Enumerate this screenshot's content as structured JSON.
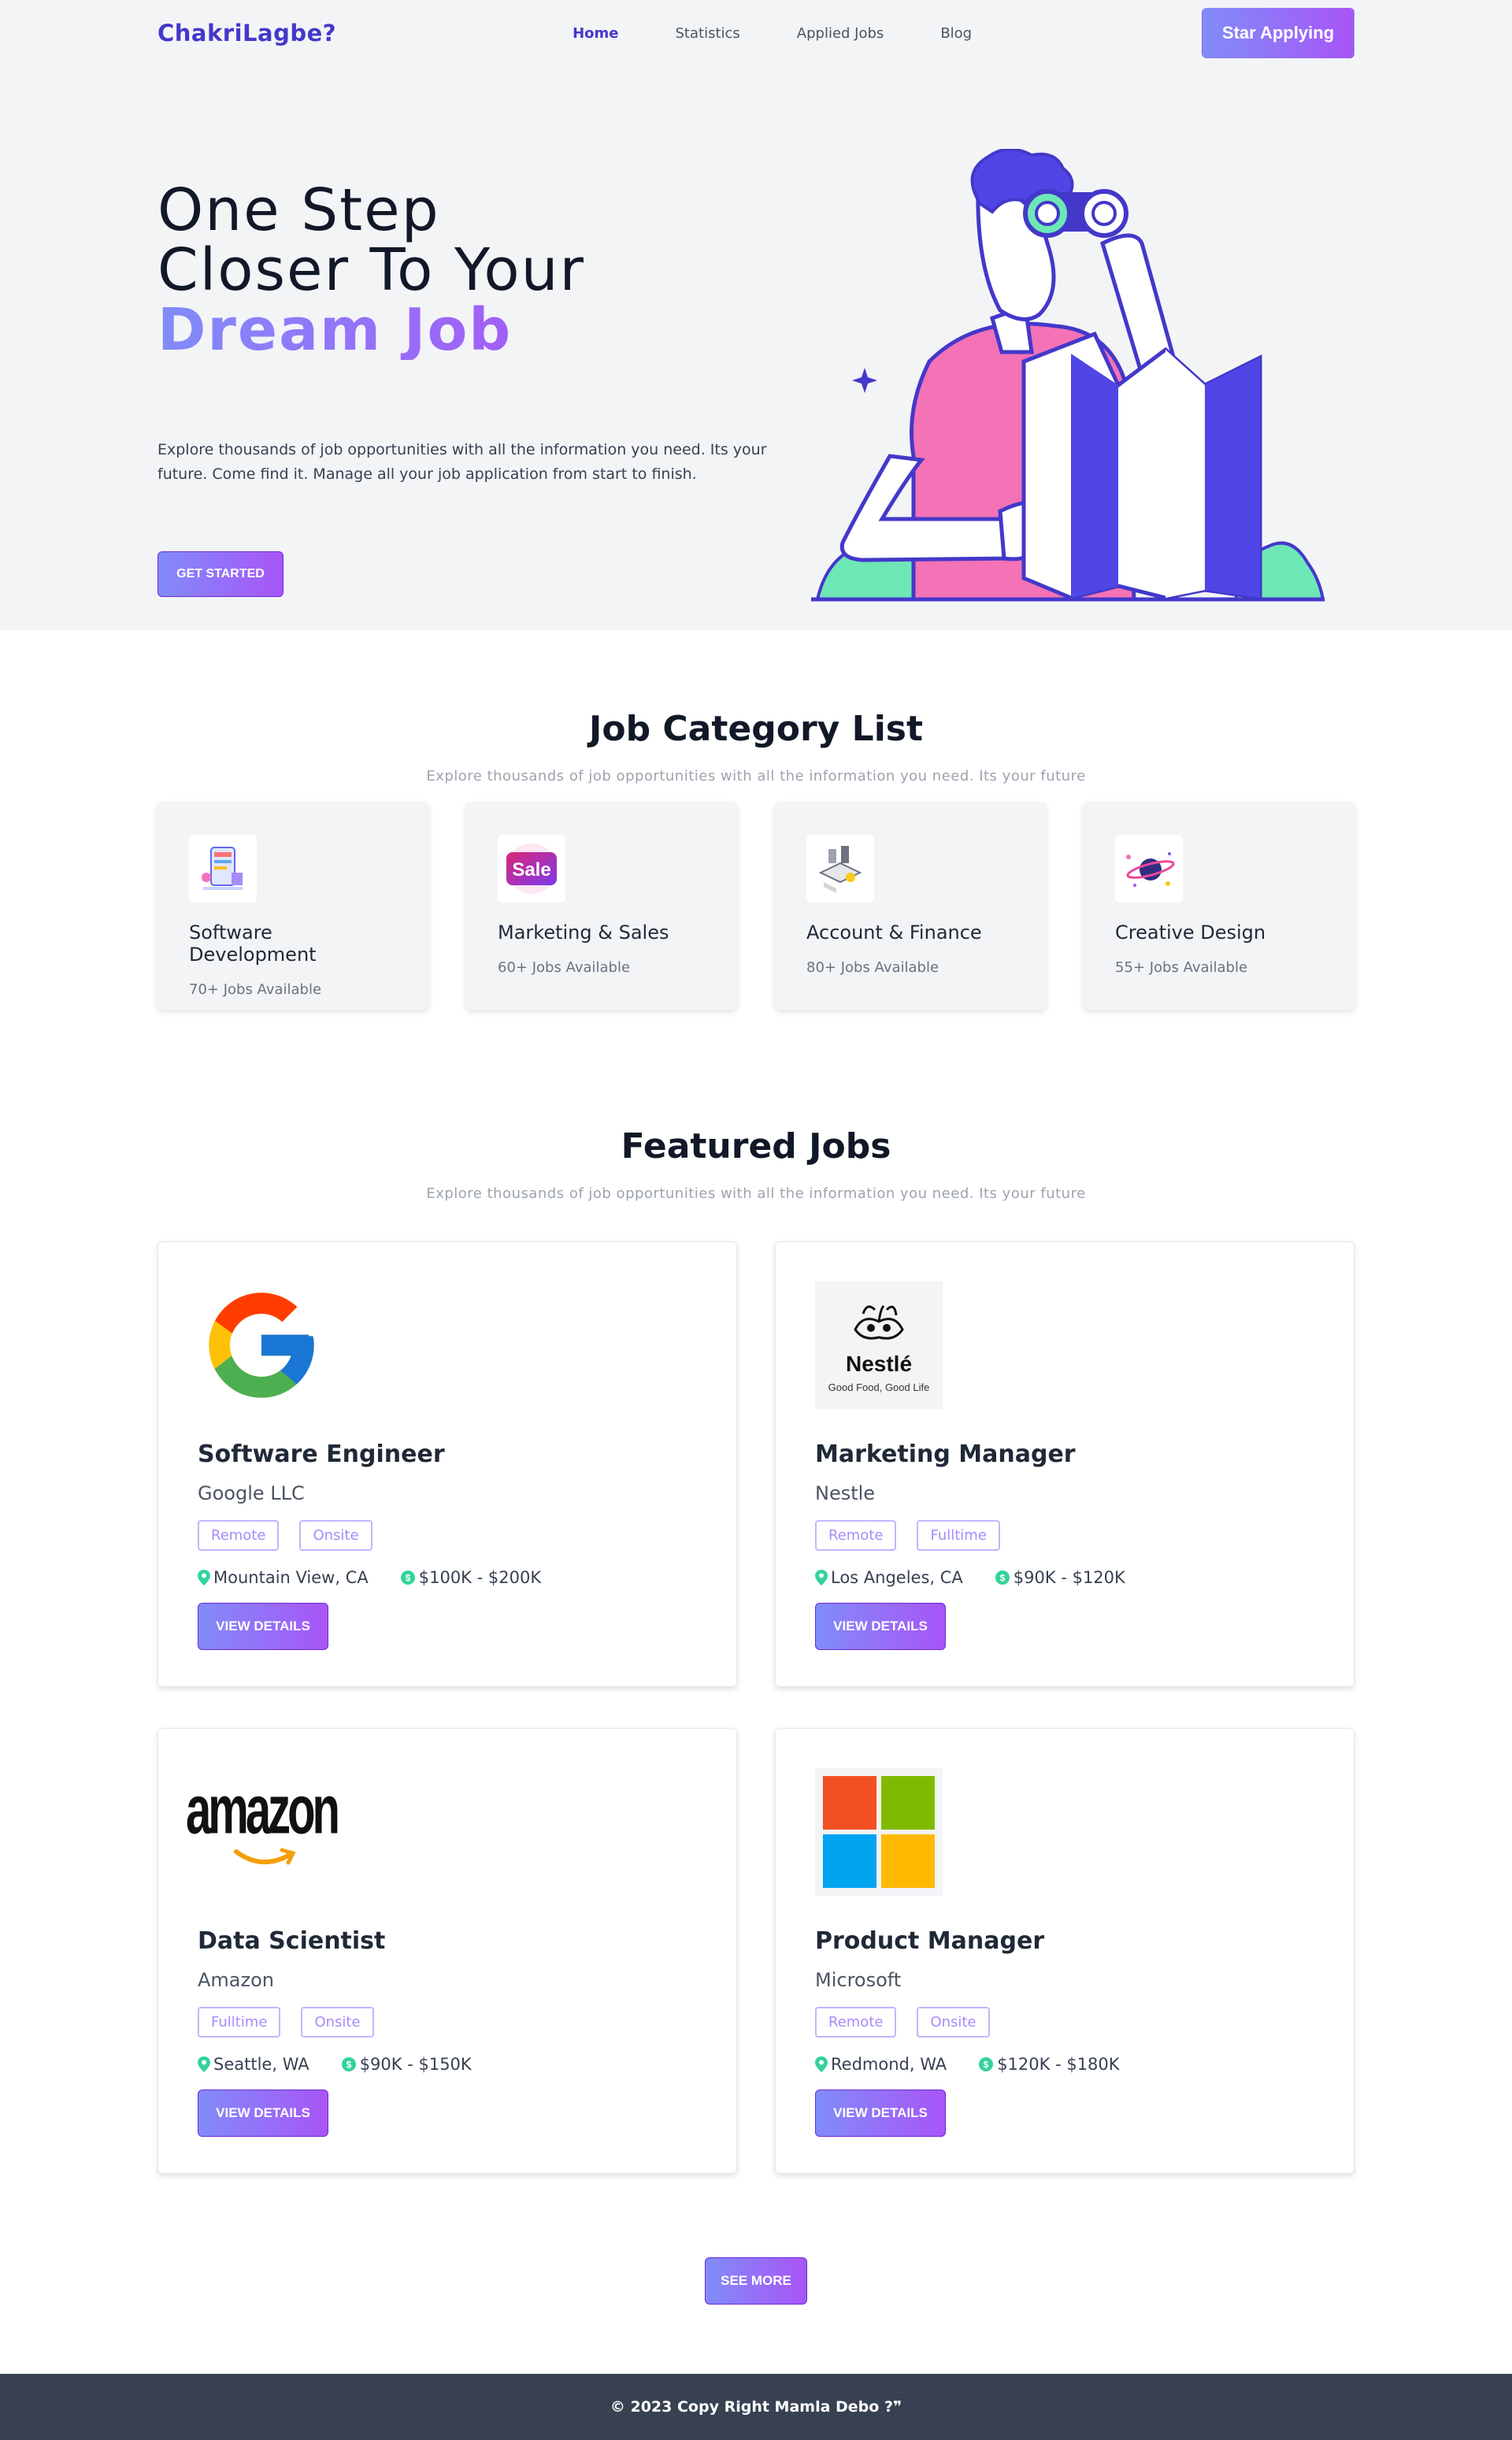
{
  "nav": {
    "brand": "ChakriLagbe?",
    "links": [
      "Home",
      "Statistics",
      "Applied Jobs",
      "Blog"
    ],
    "cta": "Star Applying"
  },
  "hero": {
    "line1": "One Step",
    "line2": "Closer To Your",
    "line3": "Dream Job",
    "description": "Explore thousands of job opportunities with all the information you need. Its your future. Come find it. Manage all your job application from start to finish.",
    "button": "GET STARTED"
  },
  "categories": {
    "title": "Job Category List",
    "subtitle": "Explore thousands of job opportunities with all the information you need. Its your future",
    "items": [
      {
        "name": "Software Development",
        "count": "70+ Jobs Available"
      },
      {
        "name": "Marketing & Sales",
        "count": "60+ Jobs Available",
        "badge": "Sale"
      },
      {
        "name": "Account & Finance",
        "count": "80+ Jobs Available"
      },
      {
        "name": "Creative Design",
        "count": "55+ Jobs Available"
      }
    ]
  },
  "featured": {
    "title": "Featured Jobs",
    "subtitle": "Explore thousands of job opportunities with all the information you need. Its your future",
    "jobs": [
      {
        "title": "Software Engineer",
        "company": "Google LLC",
        "tags": [
          "Remote",
          "Onsite"
        ],
        "location": "Mountain View, CA",
        "salary": "$100K - $200K",
        "button": "VIEW DETAILS"
      },
      {
        "title": "Marketing Manager",
        "company": "Nestle",
        "tags": [
          "Remote",
          "Fulltime"
        ],
        "location": "Los Angeles, CA",
        "salary": "$90K - $120K",
        "button": "VIEW DETAILS",
        "logo_text": "Nestlé",
        "logo_tagline": "Good Food, Good Life"
      },
      {
        "title": "Data Scientist",
        "company": "Amazon",
        "tags": [
          "Fulltime",
          "Onsite"
        ],
        "location": "Seattle, WA",
        "salary": "$90K - $150K",
        "button": "VIEW DETAILS",
        "logo_text": "amazon"
      },
      {
        "title": "Product Manager",
        "company": "Microsoft",
        "tags": [
          "Remote",
          "Onsite"
        ],
        "location": "Redmond, WA",
        "salary": "$120K - $180K",
        "button": "VIEW DETAILS"
      }
    ],
    "see_more": "SEE MORE"
  },
  "footer": {
    "text": "© 2023 Copy Right Mamla Debo ?❞"
  },
  "colors": {
    "brand": "#4338ca",
    "accent_start": "#818cf8",
    "accent_end": "#a855f7",
    "footer_bg": "#374151"
  }
}
